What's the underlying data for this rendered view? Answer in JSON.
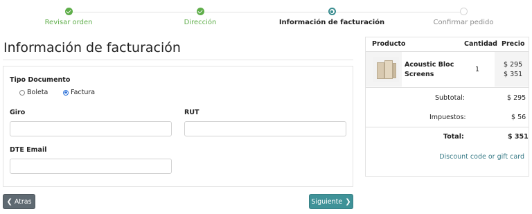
{
  "steps": [
    {
      "label": "Revisar orden",
      "state": "done"
    },
    {
      "label": "Dirección",
      "state": "done"
    },
    {
      "label": "Información de facturación",
      "state": "current"
    },
    {
      "label": "Confirmar pedido",
      "state": "todo"
    }
  ],
  "page_title": "Información de facturación",
  "form": {
    "doc_type_label": "Tipo Documento",
    "doc_types": [
      {
        "label": "Boleta",
        "selected": false
      },
      {
        "label": "Factura",
        "selected": true
      }
    ],
    "giro": {
      "label": "Giro",
      "value": "",
      "placeholder": ""
    },
    "rut": {
      "label": "RUT",
      "value": "",
      "placeholder": ""
    },
    "dte_email": {
      "label": "DTE Email",
      "value": "",
      "placeholder": ""
    }
  },
  "buttons": {
    "back_label": "Atras",
    "next_label": "Siguiente"
  },
  "summary": {
    "headers": {
      "product": "Producto",
      "quantity": "Cantidad",
      "price": "Precio"
    },
    "item": {
      "name": "Acoustic Bloc Screens",
      "quantity": "1",
      "price_list": "$ 295",
      "price_tax": "$ 351"
    },
    "subtotal_label": "Subtotal:",
    "subtotal": "$ 295",
    "taxes_label": "Impuestos:",
    "taxes": "$ 56",
    "total_label": "Total:",
    "total": "$ 351",
    "discount_link": "Discount code or gift card"
  },
  "colors": {
    "step_done": "#5fae4a",
    "step_current": "#3b8d90",
    "back_button": "#5f6a72",
    "next_button": "#3f9298",
    "link": "#3a7c88"
  }
}
